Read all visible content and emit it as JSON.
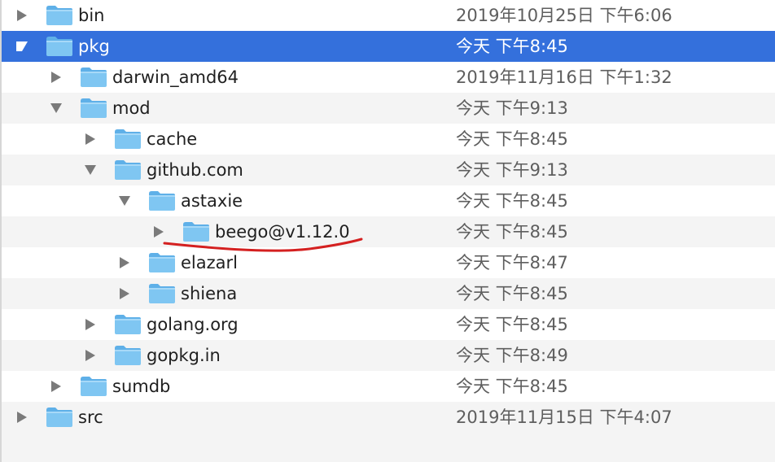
{
  "rows": [
    {
      "name": "bin",
      "date": "2019年10月25日 下午6:06",
      "level": 0,
      "expanded": false,
      "selected": false
    },
    {
      "name": "pkg",
      "date": "今天 下午8:45",
      "level": 0,
      "expanded": true,
      "selected": true
    },
    {
      "name": "darwin_amd64",
      "date": "2019年11月16日 下午1:32",
      "level": 1,
      "expanded": false,
      "selected": false
    },
    {
      "name": "mod",
      "date": "今天 下午9:13",
      "level": 1,
      "expanded": true,
      "selected": false
    },
    {
      "name": "cache",
      "date": "今天 下午8:45",
      "level": 2,
      "expanded": false,
      "selected": false
    },
    {
      "name": "github.com",
      "date": "今天 下午9:13",
      "level": 2,
      "expanded": true,
      "selected": false
    },
    {
      "name": "astaxie",
      "date": "今天 下午8:45",
      "level": 3,
      "expanded": true,
      "selected": false
    },
    {
      "name": "beego@v1.12.0",
      "date": "今天 下午8:45",
      "level": 4,
      "expanded": false,
      "selected": false
    },
    {
      "name": "elazarl",
      "date": "今天 下午8:47",
      "level": 3,
      "expanded": false,
      "selected": false
    },
    {
      "name": "shiena",
      "date": "今天 下午8:45",
      "level": 3,
      "expanded": false,
      "selected": false
    },
    {
      "name": "golang.org",
      "date": "今天 下午8:45",
      "level": 2,
      "expanded": false,
      "selected": false
    },
    {
      "name": "gopkg.in",
      "date": "今天 下午8:49",
      "level": 2,
      "expanded": false,
      "selected": false
    },
    {
      "name": "sumdb",
      "date": "今天 下午8:45",
      "level": 1,
      "expanded": false,
      "selected": false
    },
    {
      "name": "src",
      "date": "2019年11月15日 下午4:07",
      "level": 0,
      "expanded": false,
      "selected": false
    }
  ],
  "colors": {
    "selection": "#3470dc",
    "folder": "#7fc6f2",
    "folder_tab": "#5fb0e8",
    "annotation": "#d42020"
  },
  "icons": {
    "folder": "folder-icon",
    "collapsed": "disclosure-triangle-right-icon",
    "expanded": "disclosure-triangle-down-icon"
  }
}
